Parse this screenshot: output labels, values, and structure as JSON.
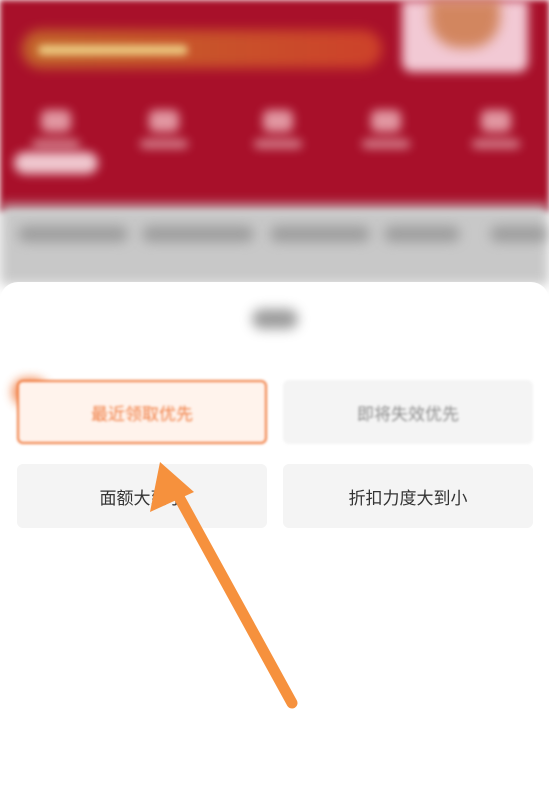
{
  "sort_sheet": {
    "options": [
      {
        "label": "最近领取优先",
        "selected": true
      },
      {
        "label": "即将失效优先",
        "selected": false
      },
      {
        "label": "面额大到小",
        "selected": false
      },
      {
        "label": "折扣力度大到小",
        "selected": false
      }
    ]
  },
  "colors": {
    "accent": "#f07b3f",
    "arrow": "#f6913d",
    "header_bg": "#a8102a"
  }
}
